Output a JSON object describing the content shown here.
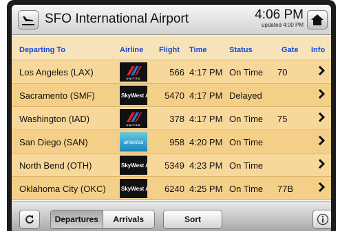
{
  "header": {
    "title": "SFO International Airport",
    "time": "4:06 PM",
    "updated": "updated 4:00 PM"
  },
  "table": {
    "columns": [
      "Departing To",
      "Airline",
      "Flight",
      "Time",
      "Status",
      "Gate",
      "Info"
    ],
    "rows": [
      {
        "dest": "Los Angeles (LAX)",
        "airline": "united",
        "airline_text": "UNITED",
        "flight": "566",
        "time": "4:17 PM",
        "status": "On Time",
        "gate": "70"
      },
      {
        "dest": "Sacramento (SMF)",
        "airline": "skywest",
        "airline_text": "SkyWest Airlines",
        "flight": "5470",
        "time": "4:17 PM",
        "status": "Delayed",
        "gate": ""
      },
      {
        "dest": "Washington (IAD)",
        "airline": "united",
        "airline_text": "UNITED",
        "flight": "378",
        "time": "4:17 PM",
        "status": "On Time",
        "gate": "75"
      },
      {
        "dest": "San Diego (SAN)",
        "airline": "virgin-america",
        "airline_text": "america",
        "flight": "958",
        "time": "4:20 PM",
        "status": "On Time",
        "gate": ""
      },
      {
        "dest": "North Bend (OTH)",
        "airline": "skywest",
        "airline_text": "SkyWest Airlines",
        "flight": "5349",
        "time": "4:23 PM",
        "status": "On Time",
        "gate": ""
      },
      {
        "dest": "Oklahoma City (OKC)",
        "airline": "skywest",
        "airline_text": "SkyWest Airlines",
        "flight": "6240",
        "time": "4:25 PM",
        "status": "On Time",
        "gate": "77B"
      }
    ]
  },
  "toolbar": {
    "departures": "Departures",
    "arrivals": "Arrivals",
    "sort": "Sort"
  },
  "icons": {
    "left": "airplane-icon",
    "right": "home-icon",
    "refresh": "refresh-icon",
    "info": "info-icon",
    "row_info": "chevron-right-icon"
  },
  "colors": {
    "header_text": "#1646d8",
    "row_bg": "#f7d79a",
    "row_alt_bg": "#f4cf88"
  }
}
